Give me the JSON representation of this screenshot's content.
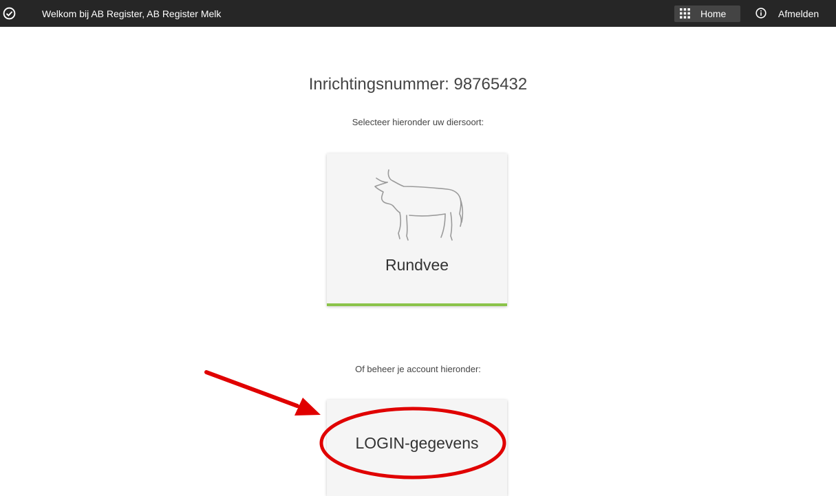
{
  "topbar": {
    "check_icon": "check-circle-icon",
    "welcome_text": "Welkom bij AB Register, AB Register Melk",
    "home_icon": "grid-icon",
    "home_label": "Home",
    "logout_icon": "info-circle-icon",
    "logout_label": "Afmelden"
  },
  "main": {
    "heading": "Inrichtingsnummer: 98765432",
    "select_prompt": "Selecteer hieronder uw diersoort:",
    "animal_tiles": [
      {
        "icon": "cow-icon",
        "label": "Rundvee",
        "accent_color": "#8bc34a"
      }
    ],
    "account_prompt": "Of beheer je account hieronder:",
    "account_tile": {
      "label": "LOGIN-gegevens"
    }
  },
  "annotation": {
    "color": "#e00000",
    "shapes": [
      "arrow",
      "ellipse"
    ]
  }
}
